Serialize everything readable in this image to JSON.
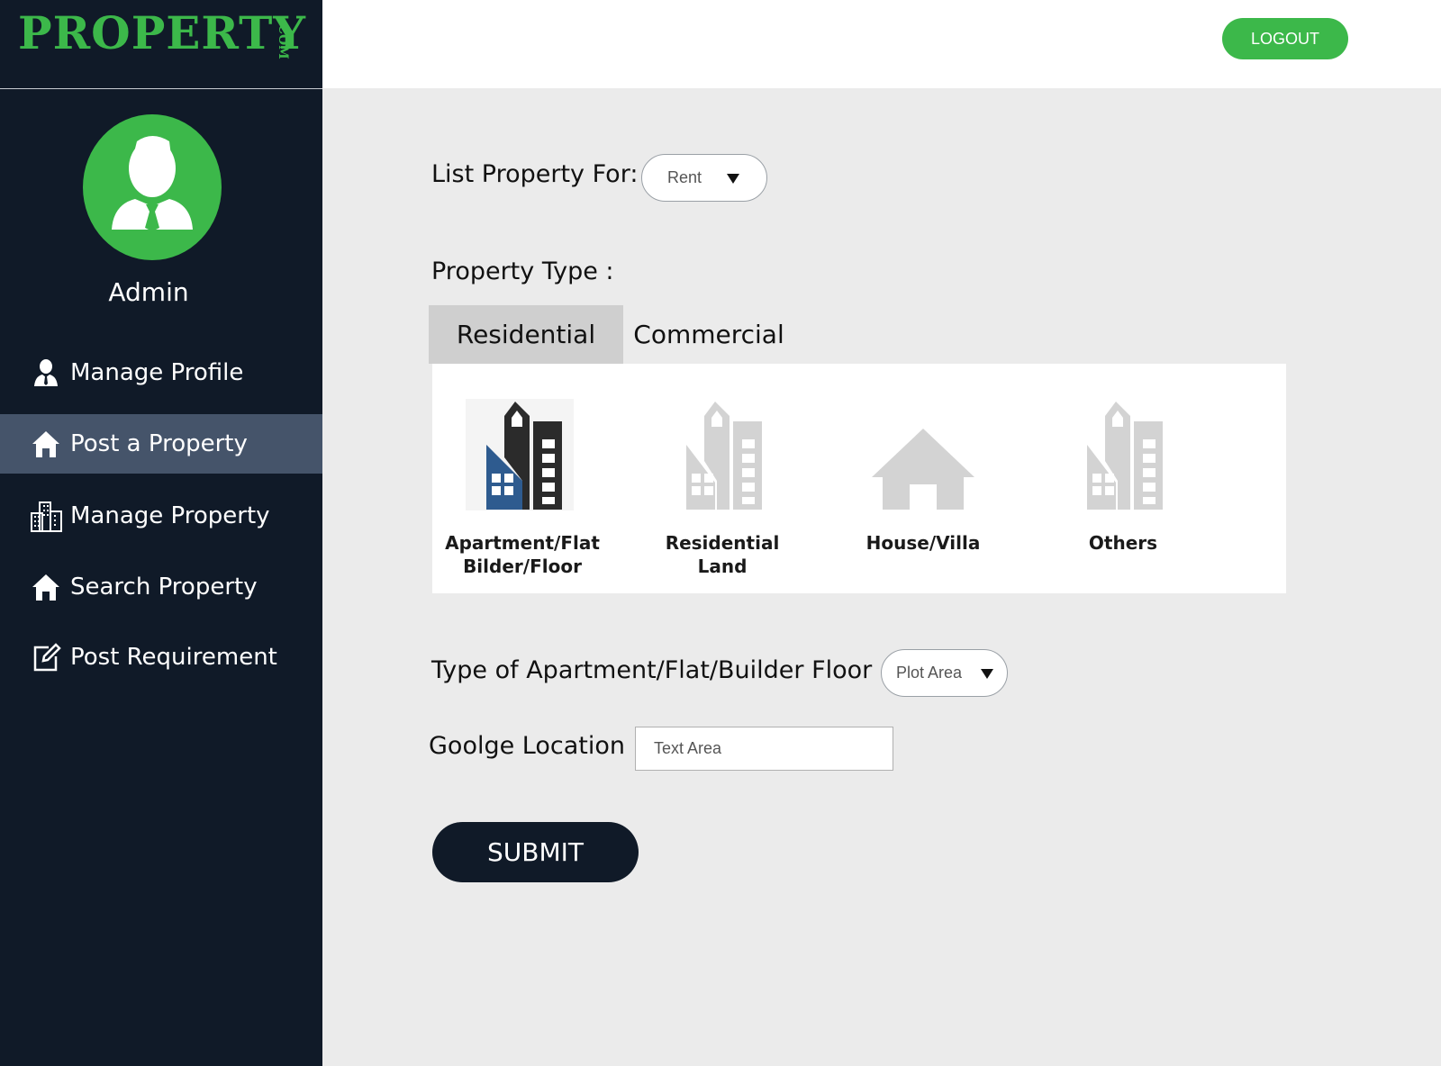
{
  "brand": {
    "name": "PROPERTY",
    "suffix": ".COM",
    "color": "#3cb84a"
  },
  "header": {
    "logout_label": "LOGOUT"
  },
  "sidebar": {
    "user_name": "Admin",
    "items": [
      {
        "label": "Manage Profile",
        "icon": "user-icon",
        "active": false
      },
      {
        "label": "Post a Property",
        "icon": "home-icon",
        "active": true
      },
      {
        "label": "Manage Property",
        "icon": "buildings-icon",
        "active": false
      },
      {
        "label": "Search Property",
        "icon": "home-icon",
        "active": false
      },
      {
        "label": "Post Requirement",
        "icon": "edit-icon",
        "active": false
      }
    ]
  },
  "form": {
    "list_for": {
      "label": "List Property For:",
      "value": "Rent"
    },
    "property_type": {
      "label": "Property Type :",
      "tabs": [
        {
          "label": "Residential",
          "active": true
        },
        {
          "label": "Commercial",
          "active": false
        }
      ],
      "options": [
        {
          "lines": [
            "Apartment/Flat",
            "Bilder/Floor"
          ],
          "icon": "apartment-building-icon",
          "selected": true
        },
        {
          "lines": [
            "Residential",
            "Land"
          ],
          "icon": "apartment-building-icon",
          "selected": false
        },
        {
          "lines": [
            "House/Villa"
          ],
          "icon": "house-icon",
          "selected": false
        },
        {
          "lines": [
            "Others"
          ],
          "icon": "apartment-building-icon",
          "selected": false
        }
      ]
    },
    "apartment_type": {
      "label": "Type of Apartment/Flat/Builder Floor",
      "value": "Plot Area"
    },
    "location": {
      "label": "Goolge Location",
      "placeholder": "Text Area"
    },
    "submit_label": "SUBMIT"
  },
  "colors": {
    "sidebar_bg": "#101a28",
    "active_item": "#45546a",
    "accent": "#3cb84a",
    "selected_blue": "#2e5b8f"
  }
}
